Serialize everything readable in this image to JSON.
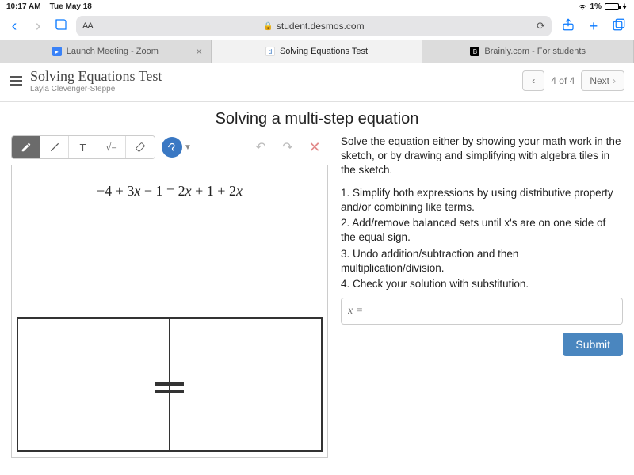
{
  "status": {
    "time": "10:17 AM",
    "date": "Tue May 18",
    "battery_pct": "1%"
  },
  "safari": {
    "url_display": "student.desmos.com",
    "tabs": [
      {
        "label": "Launch Meeting - Zoom"
      },
      {
        "label": "Solving Equations Test"
      },
      {
        "label": "Brainly.com - For students"
      }
    ]
  },
  "page": {
    "title": "Solving Equations Test",
    "subtitle": "Layla Clevenger-Steppe",
    "page_indicator": "4 of 4",
    "next_label": "Next"
  },
  "lesson": {
    "heading": "Solving a multi-step equation",
    "equation": "−4 + 3x − 1 = 2x + 1 + 2x",
    "instructions_intro": "Solve the equation either by showing your math work in the sketch, or by drawing and simplifying with algebra tiles in the sketch.",
    "steps": [
      "1. Simplify both expressions by using distributive property and/or combining like terms.",
      "2. Add/remove balanced sets until x's are on one side of the equal sign.",
      "3. Undo addition/subtraction and then multiplication/division.",
      "4. Check your solution with substitution."
    ],
    "answer_placeholder": "x =",
    "submit_label": "Submit"
  },
  "tools": {
    "pencil": "pencil",
    "line": "line",
    "text_label": "T",
    "math_label": "√=",
    "eraser": "eraser"
  }
}
